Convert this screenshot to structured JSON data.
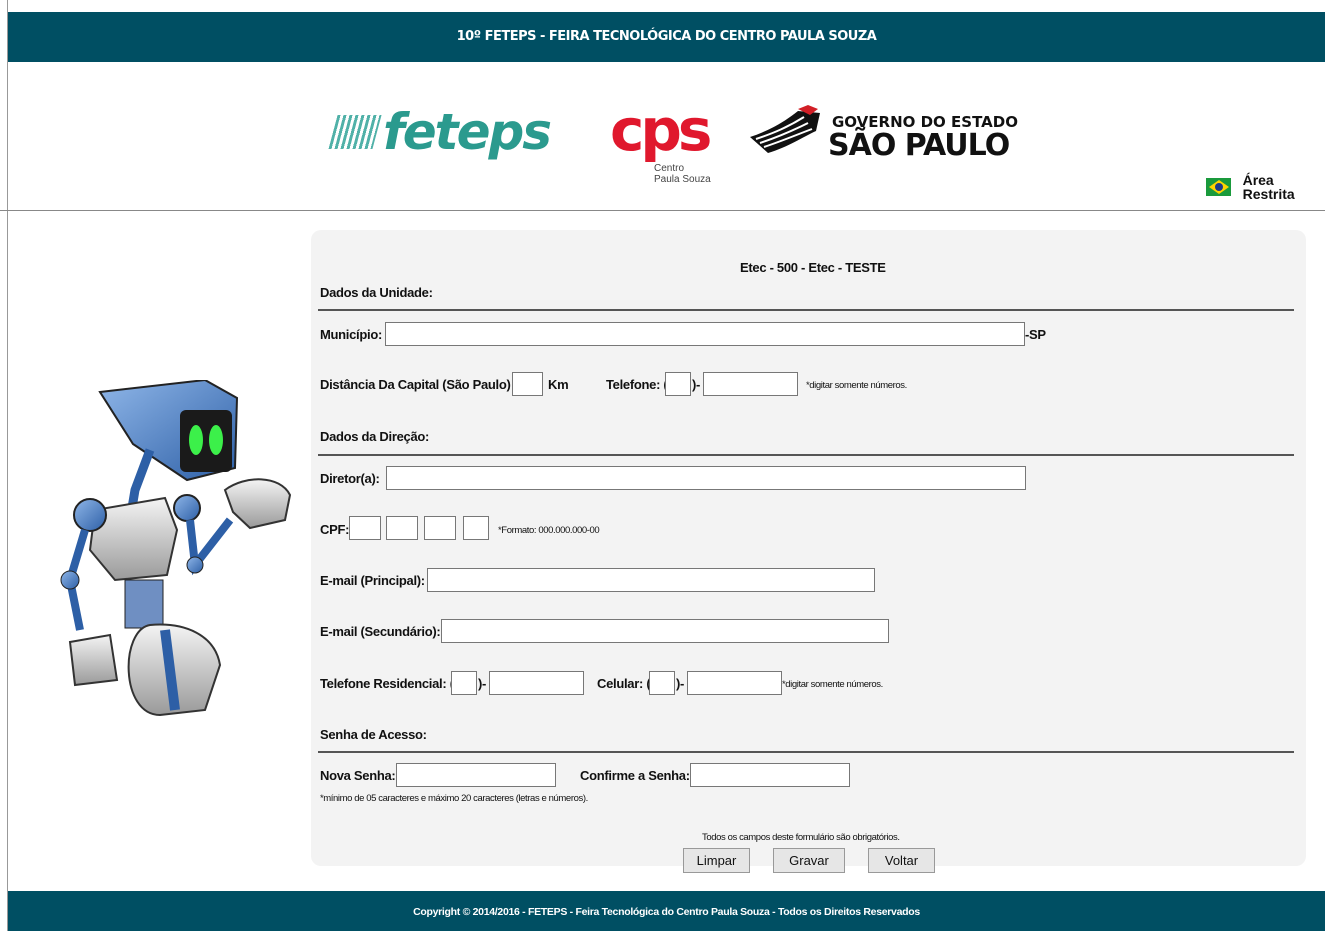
{
  "header": {
    "title": "10º FETEPS - FEIRA TECNOLÓGICA DO CENTRO PAULA SOUZA"
  },
  "logos": {
    "feteps": "feteps",
    "cps": "cps",
    "cps_sub": "Centro\nPaula Souza",
    "gov_line1": "GOVERNO DO ESTADO",
    "gov_line2": "SÃO PAULO"
  },
  "nav": {
    "restricted_area": "Área Restrita"
  },
  "form": {
    "unit_title": "Etec - 500 - Etec - TESTE",
    "section_unit": "Dados da Unidade:",
    "municipio_label": "Município:",
    "municipio_value": "",
    "state_suffix": "-SP",
    "distance_label": "Distância Da Capital (São Paulo)",
    "distance_value": "",
    "km_label": "Km",
    "phone_label": "Telefone: (",
    "phone_close": ")-",
    "phone_note": "*digitar somente números.",
    "section_direction": "Dados da Direção:",
    "director_label": "Diretor(a):",
    "director_value": "",
    "cpf_label": "CPF:",
    "cpf_note": "*Formato: 000.000.000-00",
    "email_main_label": "E-mail (Principal):",
    "email_main_value": "",
    "email_secondary_label": "E-mail (Secundário):",
    "email_secondary_value": "",
    "home_phone_label": "Telefone Residencial: (",
    "cell_label": "Celular: (",
    "cell_note": "*digitar somente números.",
    "section_password": "Senha de Acesso:",
    "new_password_label": "Nova Senha:",
    "confirm_password_label": "Confirme a Senha:",
    "password_note": "*mínimo de 05 caracteres e máximo 20 caracteres (letras e números).",
    "required_note": "Todos os campos deste formulário são obrigatórios.",
    "buttons": {
      "clear": "Limpar",
      "save": "Gravar",
      "back": "Voltar"
    }
  },
  "footer": {
    "text": "Copyright © 2014/2016 - FETEPS - Feira Tecnológica do Centro Paula Souza - Todos os Direitos Reservados"
  },
  "colors": {
    "bar": "#004f63",
    "feteps": "#2b9a8e",
    "cps": "#e0182d",
    "panel": "#f3f3f3"
  }
}
